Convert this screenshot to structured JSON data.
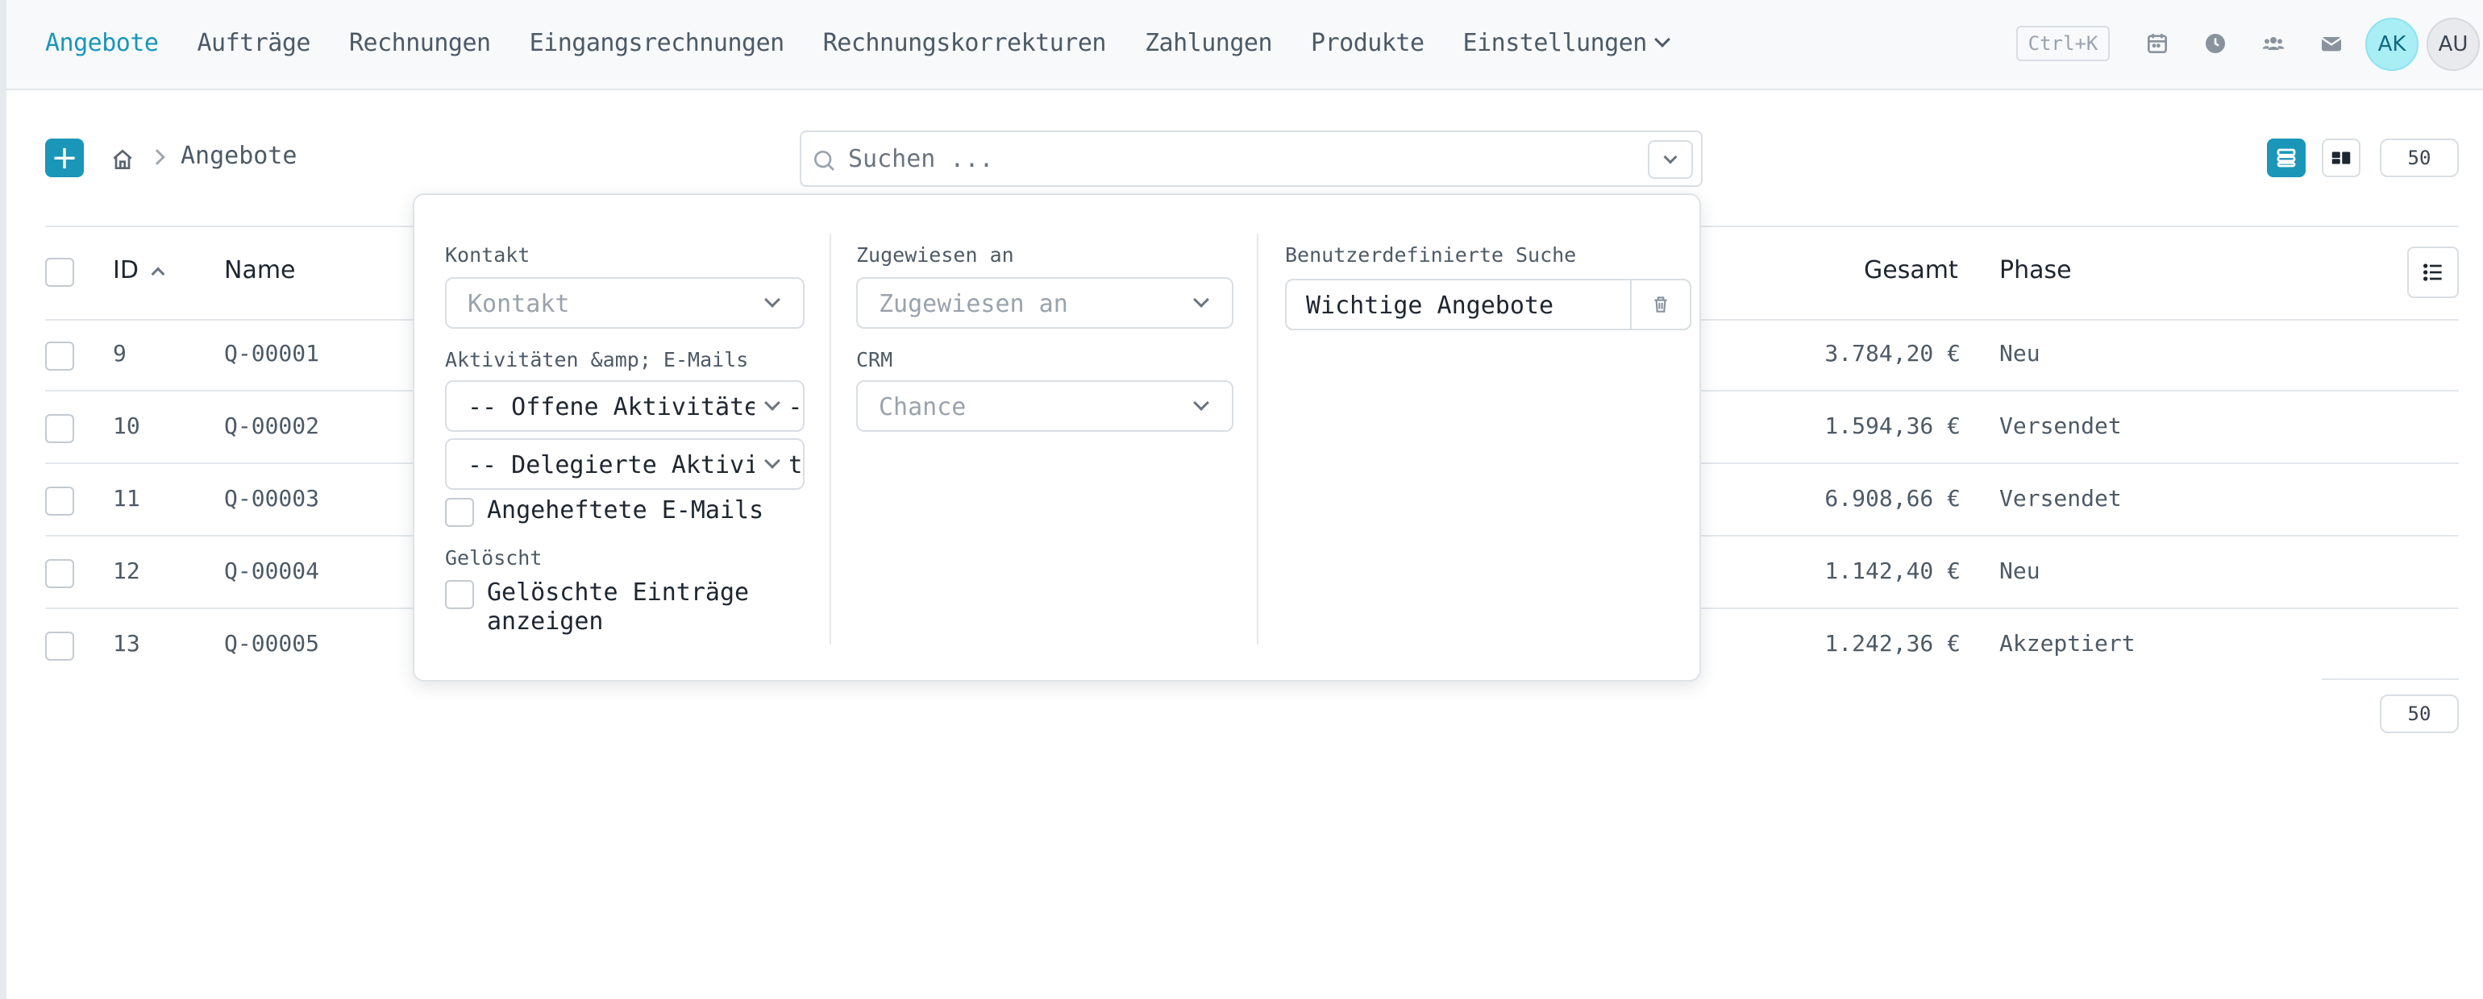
{
  "nav": {
    "items": [
      "Angebote",
      "Aufträge",
      "Rechnungen",
      "Eingangsrechnungen",
      "Rechnungskorrekturen",
      "Zahlungen",
      "Produkte",
      "Einstellungen"
    ],
    "active_index": 0,
    "shortcut": "Ctrl+K",
    "avatars": [
      "AK",
      "AU"
    ]
  },
  "toolbar": {
    "add_label": "+",
    "breadcrumb": "Angebote",
    "search_placeholder": "Suchen ...",
    "per_page": "50"
  },
  "table": {
    "headers": {
      "id": "ID",
      "name": "Name",
      "total": "Gesamt",
      "phase": "Phase"
    },
    "rows": [
      {
        "id": "9",
        "name": "Q-00001",
        "total": "3.784,20 €",
        "phase": "Neu"
      },
      {
        "id": "10",
        "name": "Q-00002",
        "total": "1.594,36 €",
        "phase": "Versendet"
      },
      {
        "id": "11",
        "name": "Q-00003",
        "total": "6.908,66 €",
        "phase": "Versendet"
      },
      {
        "id": "12",
        "name": "Q-00004",
        "total": "1.142,40 €",
        "phase": "Neu"
      },
      {
        "id": "13",
        "name": "Q-00005",
        "total": "1.242,36 €",
        "phase": "Akzeptiert"
      }
    ],
    "per_page_bottom": "50"
  },
  "filter": {
    "contact_label": "Kontakt",
    "contact_placeholder": "Kontakt",
    "activities_label": "Aktivitäten &amp; E-Mails",
    "open_activities": "-- Offene Aktivitäten --",
    "delegated_activities": "-- Delegierte Aktivitäten --",
    "pinned_emails": "Angeheftete E-Mails",
    "deleted_label": "Gelöscht",
    "show_deleted": "Gelöschte Einträge anzeigen",
    "assigned_label": "Zugewiesen an",
    "assigned_placeholder": "Zugewiesen an",
    "crm_label": "CRM",
    "crm_placeholder": "Chance",
    "custom_search_label": "Benutzerdefinierte Suche",
    "custom_search_value": "Wichtige Angebote"
  },
  "colors": {
    "accent": "#1a96b8",
    "avatar_ak": "#a9eef5"
  }
}
